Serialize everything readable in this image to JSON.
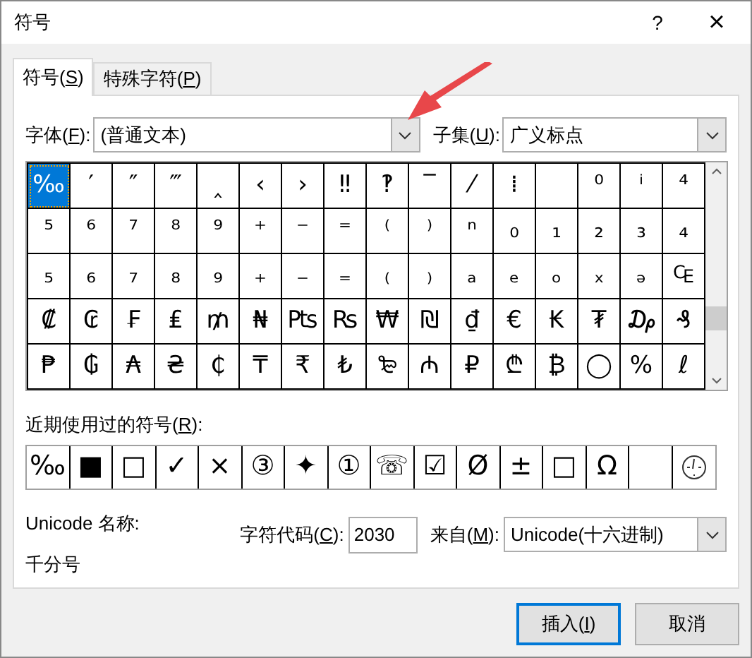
{
  "window": {
    "title": "符号",
    "help": "?",
    "close": "×"
  },
  "tabs": [
    {
      "label": "符号(",
      "key": "S",
      "after": ")",
      "selected": true
    },
    {
      "label": "特殊字符(",
      "key": "P",
      "after": ")",
      "selected": false
    }
  ],
  "font": {
    "label": "字体(",
    "key": "F",
    "after": "):",
    "value": "(普通文本)"
  },
  "subset": {
    "label": "子集(",
    "key": "U",
    "after": "):",
    "value": "广义标点"
  },
  "grid": [
    [
      {
        "symbol": "‰",
        "selected": true
      },
      {
        "symbol": "′",
        "selected": false
      },
      {
        "symbol": "″",
        "selected": false
      },
      {
        "symbol": "‴",
        "selected": false
      },
      {
        "symbol": "‸",
        "selected": false
      },
      {
        "symbol": "‹",
        "selected": false
      },
      {
        "symbol": "›",
        "selected": false
      },
      {
        "symbol": "‼",
        "selected": false
      },
      {
        "symbol": "‽",
        "selected": false
      },
      {
        "symbol": "‾",
        "selected": false
      },
      {
        "symbol": "⁄",
        "selected": false
      },
      {
        "symbol": "⁞",
        "selected": false
      },
      {
        "selected": false
      },
      {
        "symbol": "⁰",
        "selected": false
      },
      {
        "symbol": "ⁱ",
        "selected": false
      },
      {
        "symbol": "⁴",
        "selected": false
      }
    ],
    [
      {
        "symbol": "⁵",
        "selected": false
      },
      {
        "symbol": "⁶",
        "selected": false
      },
      {
        "symbol": "⁷",
        "selected": false
      },
      {
        "symbol": "⁸",
        "selected": false
      },
      {
        "symbol": "⁹",
        "selected": false
      },
      {
        "symbol": "⁺",
        "selected": false
      },
      {
        "symbol": "⁻",
        "selected": false
      },
      {
        "symbol": "⁼",
        "selected": false
      },
      {
        "symbol": "⁽",
        "selected": false
      },
      {
        "symbol": "⁾",
        "selected": false
      },
      {
        "symbol": "ⁿ",
        "selected": false
      },
      {
        "symbol": "₀",
        "selected": false
      },
      {
        "symbol": "₁",
        "selected": false
      },
      {
        "symbol": "₂",
        "selected": false
      },
      {
        "symbol": "₃",
        "selected": false
      },
      {
        "symbol": "₄",
        "selected": false
      }
    ],
    [
      {
        "symbol": "₅",
        "selected": false
      },
      {
        "symbol": "₆",
        "selected": false
      },
      {
        "symbol": "₇",
        "selected": false
      },
      {
        "symbol": "₈",
        "selected": false
      },
      {
        "symbol": "₉",
        "selected": false
      },
      {
        "symbol": "₊",
        "selected": false
      },
      {
        "symbol": "₋",
        "selected": false
      },
      {
        "symbol": "₌",
        "selected": false
      },
      {
        "symbol": "₍",
        "selected": false
      },
      {
        "symbol": "₎",
        "selected": false
      },
      {
        "symbol": "ₐ",
        "selected": false
      },
      {
        "symbol": "ₑ",
        "selected": false
      },
      {
        "symbol": "ₒ",
        "selected": false
      },
      {
        "symbol": "ₓ",
        "selected": false
      },
      {
        "symbol": "ₔ",
        "selected": false
      },
      {
        "symbol": "₠",
        "selected": false
      }
    ],
    [
      {
        "symbol": "₡",
        "selected": false
      },
      {
        "symbol": "₢",
        "selected": false
      },
      {
        "symbol": "₣",
        "selected": false
      },
      {
        "symbol": "₤",
        "selected": false
      },
      {
        "symbol": "₥",
        "selected": false
      },
      {
        "symbol": "₦",
        "selected": false
      },
      {
        "symbol": "₧",
        "selected": false
      },
      {
        "symbol": "₨",
        "selected": false
      },
      {
        "symbol": "₩",
        "selected": false
      },
      {
        "symbol": "₪",
        "selected": false
      },
      {
        "symbol": "₫",
        "selected": false
      },
      {
        "symbol": "€",
        "selected": false
      },
      {
        "symbol": "₭",
        "selected": false
      },
      {
        "symbol": "₮",
        "selected": false
      },
      {
        "symbol": "₯",
        "selected": false
      },
      {
        "symbol": "₰",
        "selected": false
      }
    ],
    [
      {
        "symbol": "₱",
        "selected": false
      },
      {
        "symbol": "₲",
        "selected": false
      },
      {
        "symbol": "₳",
        "selected": false
      },
      {
        "symbol": "₴",
        "selected": false
      },
      {
        "symbol": "₵",
        "selected": false
      },
      {
        "symbol": "₸",
        "selected": false
      },
      {
        "symbol": "₹",
        "selected": false
      },
      {
        "symbol": "₺",
        "selected": false
      },
      {
        "symbol": "₻",
        "selected": false
      },
      {
        "symbol": "₼",
        "selected": false
      },
      {
        "symbol": "₽",
        "selected": false
      },
      {
        "symbol": "₾",
        "selected": false
      },
      {
        "symbol": "₿",
        "selected": false
      },
      {
        "symbol": "◯",
        "selected": false
      },
      {
        "symbol": "%",
        "selected": false
      },
      {
        "symbol": "ℓ",
        "selected": false
      }
    ]
  ],
  "recent": {
    "label": "近期使用过的符号(",
    "key": "R",
    "after": "):",
    "items": [
      {
        "symbol": "‰"
      },
      {
        "symbol": "■"
      },
      {
        "symbol": "□"
      },
      {
        "symbol": "✓"
      },
      {
        "symbol": "×"
      },
      {
        "symbol": "③"
      },
      {
        "symbol": "✦"
      },
      {
        "symbol": "①"
      },
      {
        "symbol": "☏"
      },
      {
        "symbol": "☑"
      },
      {
        "symbol": "Ø"
      },
      {
        "symbol": "±"
      },
      {
        "symbol": "□"
      },
      {
        "symbol": "Ω"
      },
      {
        "kind": "blank"
      },
      {
        "kind": "clock"
      }
    ]
  },
  "unicode_name": {
    "label": "Unicode 名称:",
    "value": "千分号"
  },
  "char_code": {
    "label": "字符代码(",
    "key": "C",
    "after": "):",
    "value": "2030"
  },
  "from": {
    "label": "来自(",
    "key": "M",
    "after": "):",
    "value": "Unicode(十六进制)"
  },
  "buttons": [
    {
      "label": "插入(",
      "key": "I",
      "after": ")",
      "default": true
    },
    {
      "label": "取消",
      "default": false
    }
  ],
  "annotation": {
    "kind": "arrow"
  }
}
